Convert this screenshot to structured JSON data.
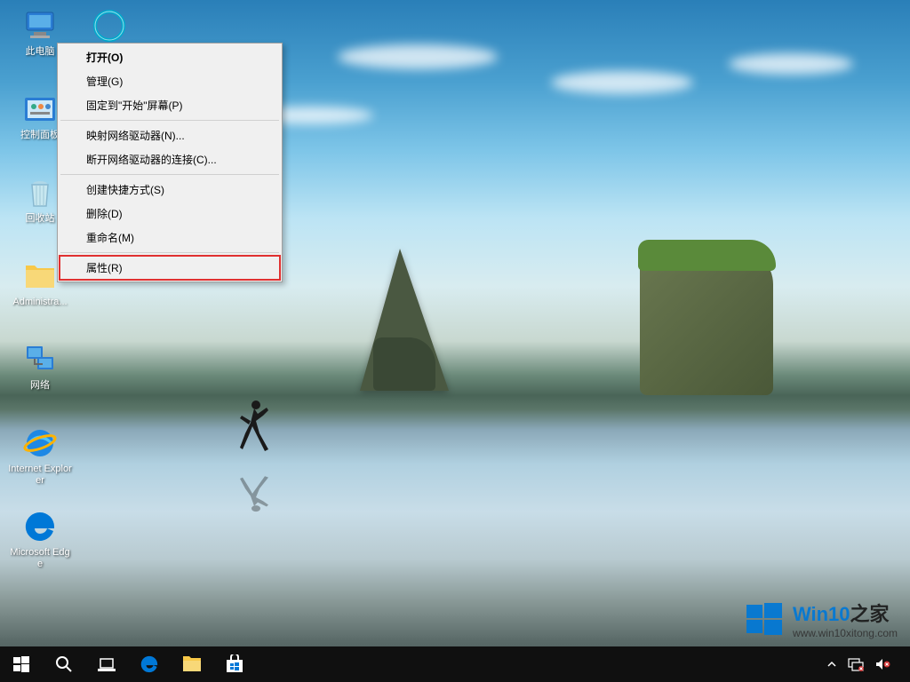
{
  "desktop_icons": [
    {
      "label": "此电脑",
      "icon": "this-pc"
    },
    {
      "label": "控制面板",
      "icon": "control-panel"
    },
    {
      "label": "回收站",
      "icon": "recycle-bin"
    },
    {
      "label": "Administra...",
      "icon": "user-folder"
    },
    {
      "label": "网络",
      "icon": "network"
    },
    {
      "label": "Internet Explorer",
      "icon": "ie"
    },
    {
      "label": "Microsoft Edge",
      "icon": "edge"
    }
  ],
  "desktop_icon_col2": {
    "label": "",
    "icon": "cortana"
  },
  "context_menu": {
    "items": [
      {
        "label": "打开(O)",
        "bold": true
      },
      {
        "label": "管理(G)"
      },
      {
        "label": "固定到\"开始\"屏幕(P)"
      },
      {
        "sep": true
      },
      {
        "label": "映射网络驱动器(N)..."
      },
      {
        "label": "断开网络驱动器的连接(C)..."
      },
      {
        "sep": true
      },
      {
        "label": "创建快捷方式(S)"
      },
      {
        "label": "删除(D)"
      },
      {
        "label": "重命名(M)"
      },
      {
        "sep": true
      },
      {
        "label": "属性(R)",
        "highlight": true
      }
    ]
  },
  "taskbar": {
    "left_buttons": [
      "start",
      "search",
      "task-view",
      "edge",
      "file-explorer",
      "store"
    ],
    "tray": {
      "chevron": "˄",
      "network": "net",
      "volume": "vol"
    },
    "clock": {
      "time": "",
      "date": ""
    }
  },
  "watermark": {
    "title_main": "Win10",
    "title_suffix": "之家",
    "url": "www.win10xitong.com"
  }
}
